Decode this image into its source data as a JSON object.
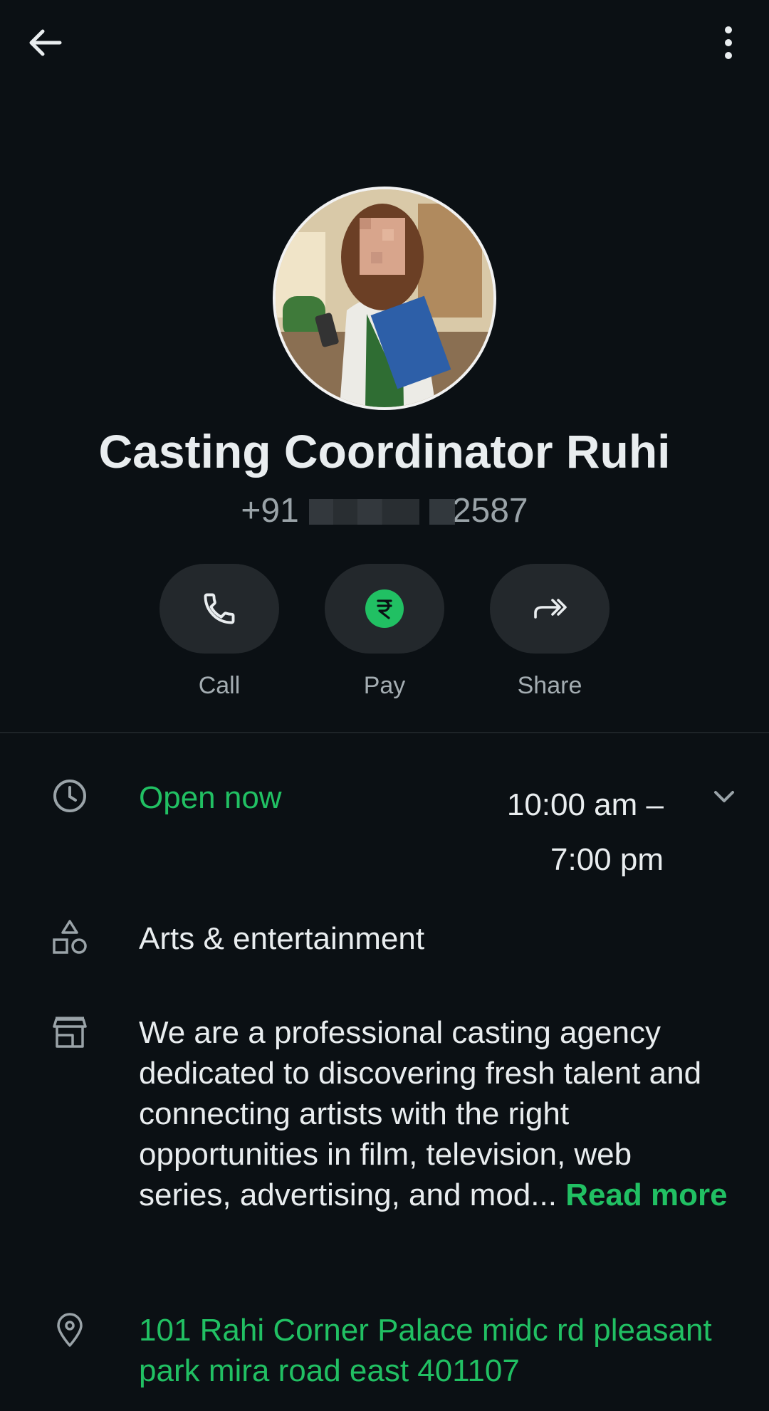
{
  "header": {
    "back_icon": "arrow-left-icon",
    "menu_icon": "more-vertical-icon"
  },
  "profile": {
    "name": "Casting Coordinator Ruhi",
    "phone_prefix": "+91",
    "phone_suffix": "2587"
  },
  "actions": [
    {
      "label": "Call",
      "icon": "phone-icon"
    },
    {
      "label": "Pay",
      "icon": "rupee-icon"
    },
    {
      "label": "Share",
      "icon": "share-forward-icon"
    }
  ],
  "details": {
    "status": "Open now",
    "hours_line1": "10:00 am –",
    "hours_line2": "7:00 pm",
    "category": "Arts & entertainment",
    "description": "We are a professional casting agency dedicated to discovering fresh talent and connecting artists with the right opportunities in film, television, web series, advertising, and mod...",
    "read_more": "Read more",
    "address": "101 Rahi Corner Palace midc rd pleasant park mira road east 401107"
  },
  "colors": {
    "accent": "#21c063",
    "background": "#0b1014",
    "button_bg": "#23282c"
  }
}
